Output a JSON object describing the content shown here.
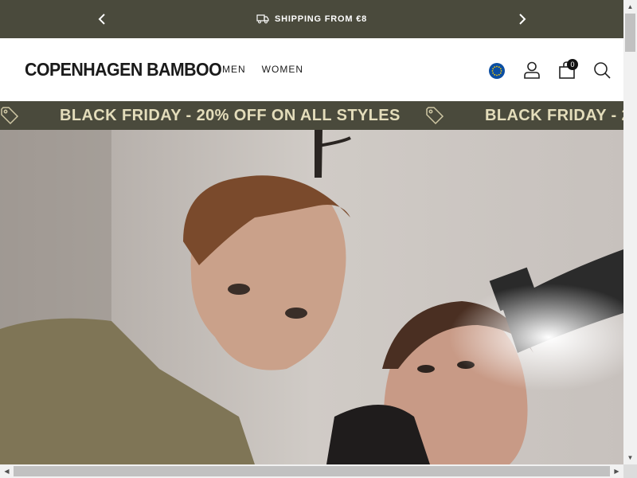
{
  "announcement": {
    "text": "SHIPPING FROM €8",
    "prev_icon": "chevron-left-icon",
    "next_icon": "chevron-right-icon",
    "message_icon": "truck-icon"
  },
  "header": {
    "logo": "COPENHAGEN BAMBOO",
    "nav": [
      {
        "label": "MEN"
      },
      {
        "label": "WOMEN"
      }
    ],
    "cart_count": "0",
    "icons": [
      "eu-flag-icon",
      "account-icon",
      "cart-icon",
      "search-icon"
    ]
  },
  "promo": {
    "text": "BLACK FRIDAY - 20% OFF ON ALL STYLES",
    "icon": "price-tag-icon"
  },
  "hero": {
    "image": "photo of a young man and woman looking down at camera"
  },
  "colors": {
    "bar_bg": "#4a4a3c",
    "promo_text": "#e4ddbb",
    "flag_blue": "#0b4ea2",
    "flag_stars": "#ffcc00"
  }
}
